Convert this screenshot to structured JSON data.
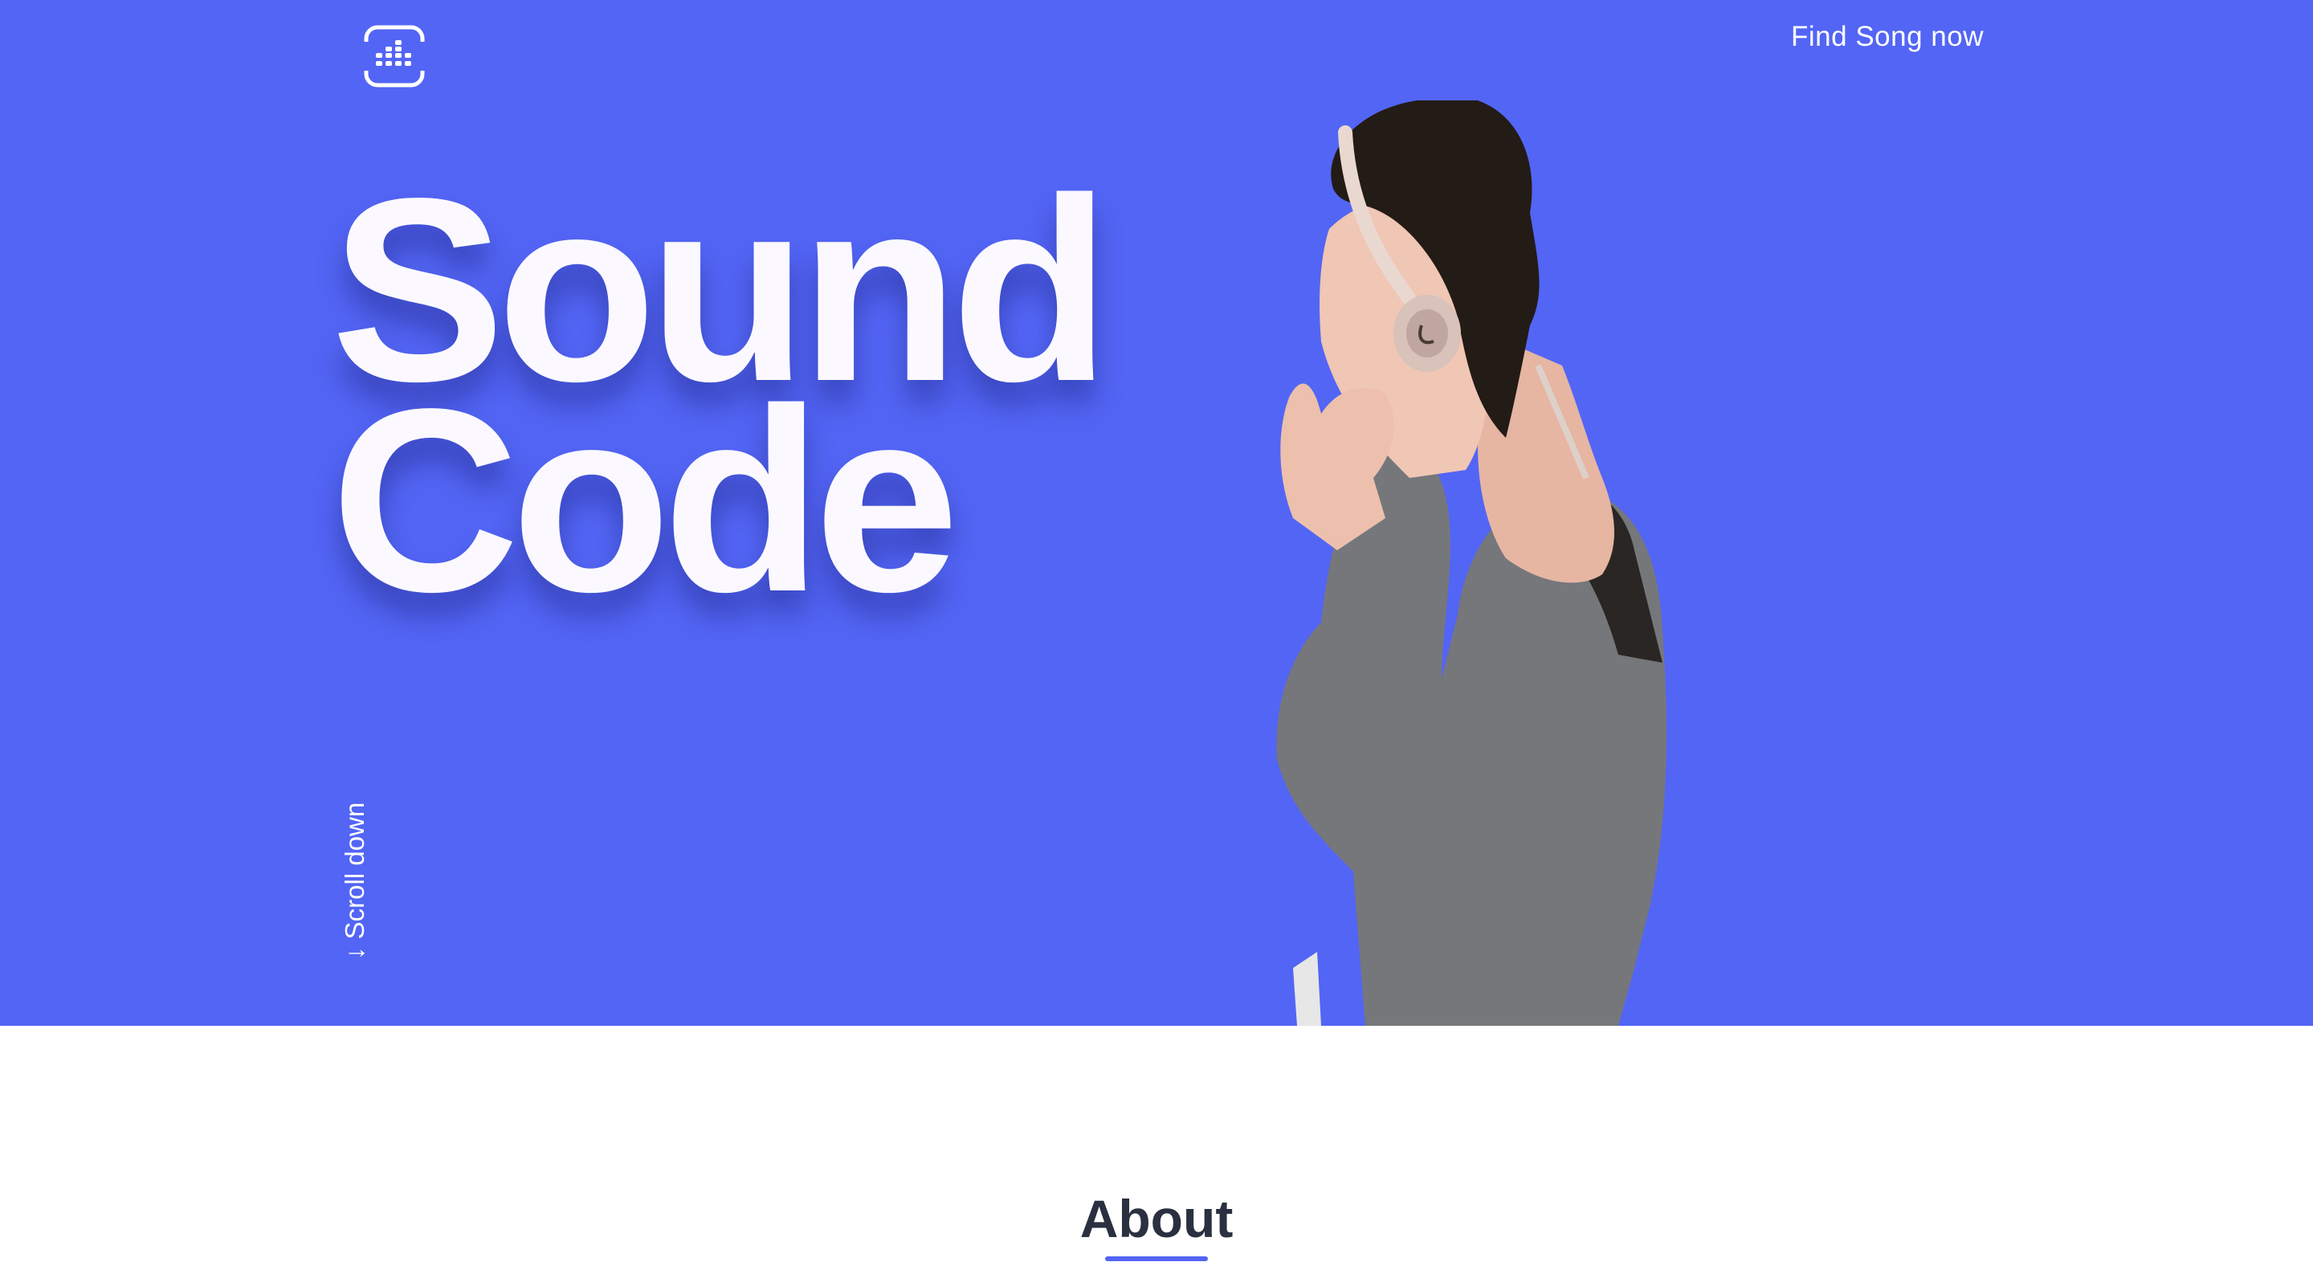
{
  "header": {
    "logo_name": "equalizer-logo-icon",
    "nav_link": "Find Song now"
  },
  "hero": {
    "headline_line1": "Sound",
    "headline_line2": "Code",
    "scroll_hint": "↓ Scroll down",
    "background_color": "#5365f5",
    "image_alt": "Woman listening with headphones"
  },
  "about": {
    "title": "About",
    "accent_color": "#5365f5"
  }
}
